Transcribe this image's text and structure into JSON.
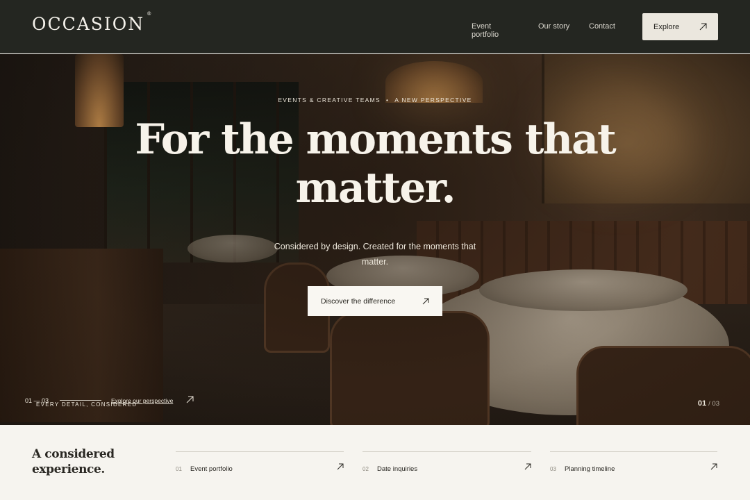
{
  "header": {
    "logo": "OCCASION",
    "logo_mark": "®",
    "nav": [
      "Event portfolio",
      "Our story",
      "Contact"
    ],
    "cta_label": "Explore",
    "cta_icon": "arrow-up-right-icon"
  },
  "hero": {
    "eyebrow_left": "EVENTS & CREATIVE TEAMS",
    "eyebrow_sep": "•",
    "eyebrow_right": "A NEW PERSPECTIVE",
    "headline_line1": "For the moments that",
    "headline_line2": "matter.",
    "subtitle": "Considered by design. Created for the moments that matter.",
    "cta_label": "Discover the difference",
    "slide_range": "01 — 03",
    "slide_caption": "EVERY DETAIL, CONSIDERED",
    "perspective_link": "Explore our perspective",
    "slide_current": "01",
    "slide_total": "/ 03"
  },
  "bottom": {
    "title_line1": "A considered",
    "title_line2": "experience.",
    "items": [
      {
        "num": "01",
        "label": "Event portfolio"
      },
      {
        "num": "02",
        "label": "Date inquiries"
      },
      {
        "num": "03",
        "label": "Planning timeline"
      }
    ]
  },
  "colors": {
    "header_bg": "#242621",
    "cream": "#f6f4ef",
    "text_dark": "#2a2823"
  }
}
